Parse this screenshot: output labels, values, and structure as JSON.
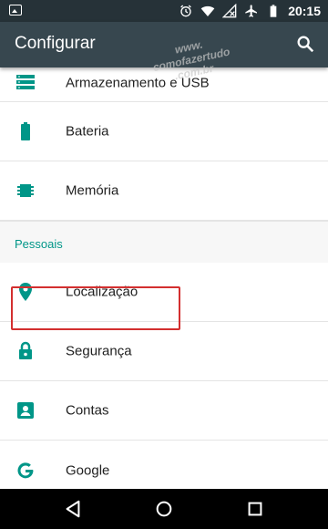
{
  "status": {
    "time": "20:15",
    "icons": [
      "image-icon",
      "alarm-icon",
      "wifi-icon",
      "no-signal-icon",
      "airplane-icon",
      "battery-icon"
    ]
  },
  "appbar": {
    "title": "Configurar",
    "search_icon": "search-icon"
  },
  "watermark": {
    "line1": "www.",
    "line2": "comofazertudo",
    "line3": ".com.br"
  },
  "list_top": [
    {
      "label": "Armazenamento e USB",
      "icon": "storage-icon"
    },
    {
      "label": "Bateria",
      "icon": "battery-icon"
    },
    {
      "label": "Memória",
      "icon": "memory-icon"
    }
  ],
  "section": {
    "title": "Pessoais",
    "items": [
      {
        "label": "Localização",
        "icon": "location-icon"
      },
      {
        "label": "Segurança",
        "icon": "lock-icon"
      },
      {
        "label": "Contas",
        "icon": "account-icon"
      },
      {
        "label": "Google",
        "icon": "google-icon"
      }
    ]
  },
  "colors": {
    "accent": "#009688",
    "appbar": "#37474f",
    "statusbar": "#263238",
    "highlight": "#d32f2f"
  },
  "navbar": {
    "buttons": [
      "back-icon",
      "home-icon",
      "recents-icon"
    ]
  }
}
